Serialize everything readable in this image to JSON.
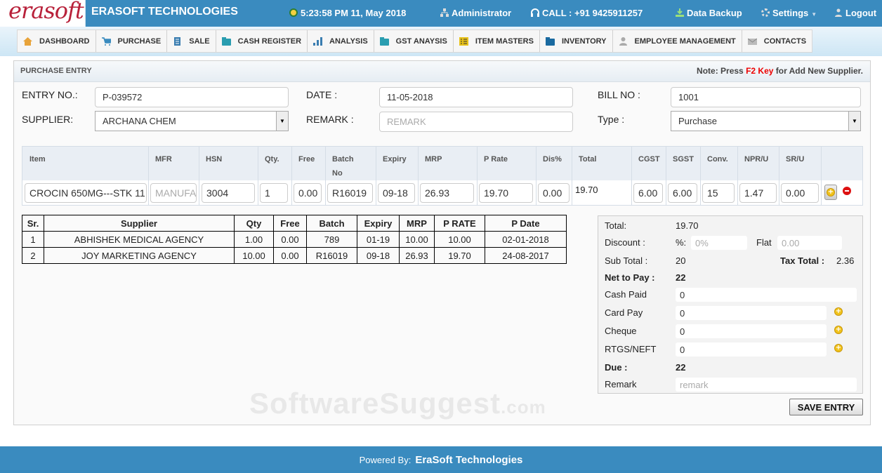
{
  "app": {
    "logo_text": "erasoft",
    "brand": "ERASOFT TECHNOLOGIES",
    "datetime": "5:23:58 PM 11, May 2018",
    "user": "Administrator",
    "call": "CALL : +91 9425911257",
    "backup": "Data Backup",
    "settings": "Settings",
    "logout": "Logout"
  },
  "nav": [
    {
      "label": "DASHBOARD",
      "icon": "home-icon"
    },
    {
      "label": "PURCHASE",
      "icon": "cart-icon"
    },
    {
      "label": "SALE",
      "icon": "document-icon"
    },
    {
      "label": "CASH REGISTER",
      "icon": "folder-icon"
    },
    {
      "label": "ANALYSIS",
      "icon": "bar-chart-icon"
    },
    {
      "label": "GST ANAYSIS",
      "icon": "folder-icon"
    },
    {
      "label": "ITEM MASTERS",
      "icon": "list-icon"
    },
    {
      "label": "INVENTORY",
      "icon": "folder-icon"
    },
    {
      "label": "EMPLOYEE MANAGEMENT",
      "icon": "user-icon"
    },
    {
      "label": "CONTACTS",
      "icon": "mail-icon"
    }
  ],
  "panel": {
    "title": "PURCHASE ENTRY",
    "note_prefix": "Note: Press ",
    "note_key": "F2 Key",
    "note_suffix": " for Add New Supplier."
  },
  "form": {
    "entry_no_label": "ENTRY NO.:",
    "entry_no": "P-039572",
    "date_label": "DATE :",
    "date": "11-05-2018",
    "bill_no_label": "BILL NO :",
    "bill_no": "1001",
    "supplier_label": "SUPPLIER:",
    "supplier": "ARCHANA CHEM",
    "remark_label": "REMARK :",
    "remark_placeholder": "REMARK",
    "type_label": "Type :",
    "type": "Purchase"
  },
  "item_grid": {
    "headers": {
      "item": "Item",
      "mfr": "MFR",
      "hsn": "HSN",
      "qty": "Qty.",
      "free": "Free",
      "batch": "Batch",
      "batch2": "No",
      "expiry": "Expiry",
      "mrp": "MRP",
      "prate": "P Rate",
      "dis": "Dis%",
      "total": "Total",
      "cgst": "CGST",
      "sgst": "SGST",
      "conv": "Conv.",
      "npr": "NPR/U",
      "sr": "SR/U"
    },
    "row": {
      "item": "CROCIN 650MG---STK 11",
      "mfr_placeholder": "MANUFACTURER",
      "hsn": "3004",
      "qty": "1",
      "free": "0.00",
      "batch": "R16019",
      "expiry": "09-18",
      "mrp": "26.93",
      "prate": "19.70",
      "dis": "0.00",
      "total": "19.70",
      "cgst": "6.00",
      "sgst": "6.00",
      "conv": "15",
      "npr": "1.47",
      "sr": "0.00"
    }
  },
  "history": {
    "headers": [
      "Sr.",
      "Supplier",
      "Qty",
      "Free",
      "Batch",
      "Expiry",
      "MRP",
      "P RATE",
      "P Date"
    ],
    "rows": [
      [
        "1",
        "ABHISHEK MEDICAL AGENCY",
        "1.00",
        "0.00",
        "789",
        "01-19",
        "10.00",
        "10.00",
        "02-01-2018"
      ],
      [
        "2",
        "JOY MARKETING AGENCY",
        "10.00",
        "0.00",
        "R16019",
        "09-18",
        "26.93",
        "19.70",
        "24-08-2017"
      ]
    ]
  },
  "summary": {
    "total_label": "Total:",
    "total": "19.70",
    "discount_label": "Discount :",
    "pct_label": "%:",
    "pct_placeholder": "0%",
    "flat_label": "Flat",
    "flat_placeholder": "0.00",
    "subtotal_label": "Sub Total :",
    "subtotal": "20",
    "taxtotal_label": "Tax Total :",
    "taxtotal": "2.36",
    "net_label": "Net to Pay :",
    "net": "22",
    "cash_label": "Cash Paid",
    "cash": "0",
    "card_label": "Card Pay",
    "card": "0",
    "cheque_label": "Cheque",
    "cheque": "0",
    "rtgs_label": "RTGS/NEFT",
    "rtgs": "0",
    "due_label": "Due :",
    "due": "22",
    "remark_label": "Remark",
    "remark_placeholder": "remark"
  },
  "save_label": "SAVE ENTRY",
  "watermark": {
    "main": "SoftwareSuggest",
    "suffix": ".com"
  },
  "footer": {
    "prefix": "Powered By:",
    "company": "EraSoft Technologies"
  },
  "colors": {
    "header_blue": "#3a8bbf",
    "brand_red": "#b8213a",
    "note_red": "#ee0000",
    "add_yellow": "#f0c21a",
    "remove_red": "#dd1111"
  }
}
